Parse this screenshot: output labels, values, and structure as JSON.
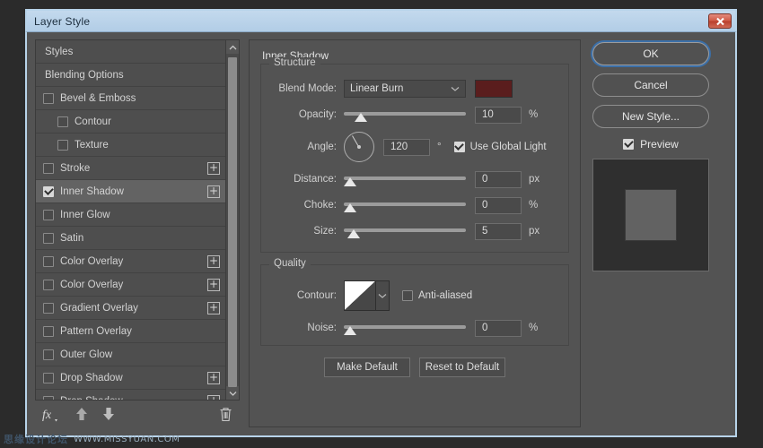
{
  "window": {
    "title": "Layer Style",
    "close_icon": "close-x-icon"
  },
  "styles_panel": {
    "items": [
      {
        "label": "Styles",
        "type": "header",
        "checkbox": null,
        "indent": 0,
        "plus": false,
        "selected": false
      },
      {
        "label": "Blending Options",
        "type": "header",
        "checkbox": null,
        "indent": 0,
        "plus": false,
        "selected": false
      },
      {
        "label": "Bevel & Emboss",
        "type": "effect",
        "checkbox": false,
        "indent": 0,
        "plus": false,
        "selected": false
      },
      {
        "label": "Contour",
        "type": "effect",
        "checkbox": false,
        "indent": 1,
        "plus": false,
        "selected": false
      },
      {
        "label": "Texture",
        "type": "effect",
        "checkbox": false,
        "indent": 1,
        "plus": false,
        "selected": false
      },
      {
        "label": "Stroke",
        "type": "effect",
        "checkbox": false,
        "indent": 0,
        "plus": true,
        "selected": false
      },
      {
        "label": "Inner Shadow",
        "type": "effect",
        "checkbox": true,
        "indent": 0,
        "plus": true,
        "selected": true
      },
      {
        "label": "Inner Glow",
        "type": "effect",
        "checkbox": false,
        "indent": 0,
        "plus": false,
        "selected": false
      },
      {
        "label": "Satin",
        "type": "effect",
        "checkbox": false,
        "indent": 0,
        "plus": false,
        "selected": false
      },
      {
        "label": "Color Overlay",
        "type": "effect",
        "checkbox": false,
        "indent": 0,
        "plus": true,
        "selected": false
      },
      {
        "label": "Color Overlay",
        "type": "effect",
        "checkbox": false,
        "indent": 0,
        "plus": true,
        "selected": false
      },
      {
        "label": "Gradient Overlay",
        "type": "effect",
        "checkbox": false,
        "indent": 0,
        "plus": true,
        "selected": false
      },
      {
        "label": "Pattern Overlay",
        "type": "effect",
        "checkbox": false,
        "indent": 0,
        "plus": false,
        "selected": false
      },
      {
        "label": "Outer Glow",
        "type": "effect",
        "checkbox": false,
        "indent": 0,
        "plus": false,
        "selected": false
      },
      {
        "label": "Drop Shadow",
        "type": "effect",
        "checkbox": false,
        "indent": 0,
        "plus": true,
        "selected": false
      },
      {
        "label": "Drop Shadow",
        "type": "effect",
        "checkbox": false,
        "indent": 0,
        "plus": true,
        "selected": false
      }
    ],
    "scrollbar": {
      "up_icon": "chevron-up-icon",
      "down_icon": "chevron-down-icon"
    },
    "toolbar": {
      "fx_icon": "fx-icon",
      "move_up_icon": "arrow-up-icon",
      "move_down_icon": "arrow-down-icon",
      "delete_icon": "trash-icon"
    }
  },
  "effect_panel": {
    "title": "Inner Shadow",
    "structure": {
      "legend": "Structure",
      "blend_mode": {
        "label": "Blend Mode:",
        "value": "Linear Burn",
        "chevron_icon": "chevron-down-icon",
        "color": "#5a1d1d"
      },
      "opacity": {
        "label": "Opacity:",
        "value": "10",
        "unit": "%",
        "slider_pct": 10
      },
      "angle": {
        "label": "Angle:",
        "value": "120",
        "unit": "°",
        "degrees": 120,
        "global_light": {
          "label": "Use Global Light",
          "checked": true
        }
      },
      "distance": {
        "label": "Distance:",
        "value": "0",
        "unit": "px",
        "slider_pct": 0
      },
      "choke": {
        "label": "Choke:",
        "value": "0",
        "unit": "%",
        "slider_pct": 0
      },
      "size": {
        "label": "Size:",
        "value": "5",
        "unit": "px",
        "slider_pct": 3
      }
    },
    "quality": {
      "legend": "Quality",
      "contour": {
        "label": "Contour:",
        "chevron_icon": "chevron-down-icon",
        "anti_aliased": {
          "label": "Anti-aliased",
          "checked": false
        }
      },
      "noise": {
        "label": "Noise:",
        "value": "0",
        "unit": "%",
        "slider_pct": 0
      }
    },
    "make_default": "Make Default",
    "reset_to_default": "Reset to Default"
  },
  "actions": {
    "ok": "OK",
    "cancel": "Cancel",
    "new_style": "New Style...",
    "preview": {
      "label": "Preview",
      "checked": true
    }
  },
  "watermark": {
    "cn": "思缘设计论坛",
    "en": "WWW.MISSYUAN.COM"
  }
}
